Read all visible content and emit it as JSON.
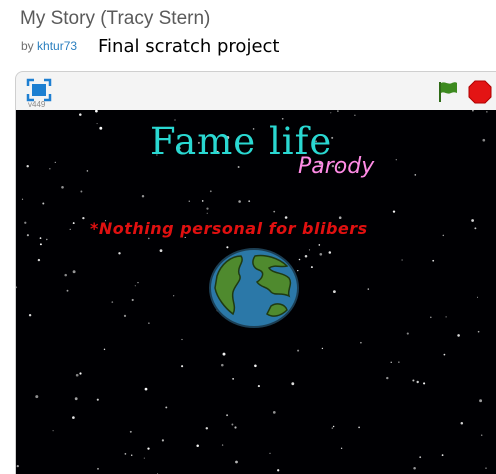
{
  "project": {
    "title": "My Story (Tracy Stern)",
    "by_prefix": "by",
    "author": "khtur73",
    "note": "Final scratch project"
  },
  "player": {
    "version": "v449",
    "fullscreen_icon": "fullscreen-icon",
    "flag_icon": "green-flag-icon",
    "stop_icon": "stop-sign-icon",
    "colors": {
      "flag": "#3d8a1f",
      "stop": "#e31414"
    }
  },
  "stage": {
    "heading": "Fame life",
    "subheading": "Parody",
    "banner": "*Nothing personal for blibers",
    "colors": {
      "background": "#000003",
      "heading": "#2ad8d2",
      "subheading": "#ff8be6",
      "banner": "#e01010",
      "ocean": "#2b78a8",
      "land": "#4f8a2e"
    }
  }
}
